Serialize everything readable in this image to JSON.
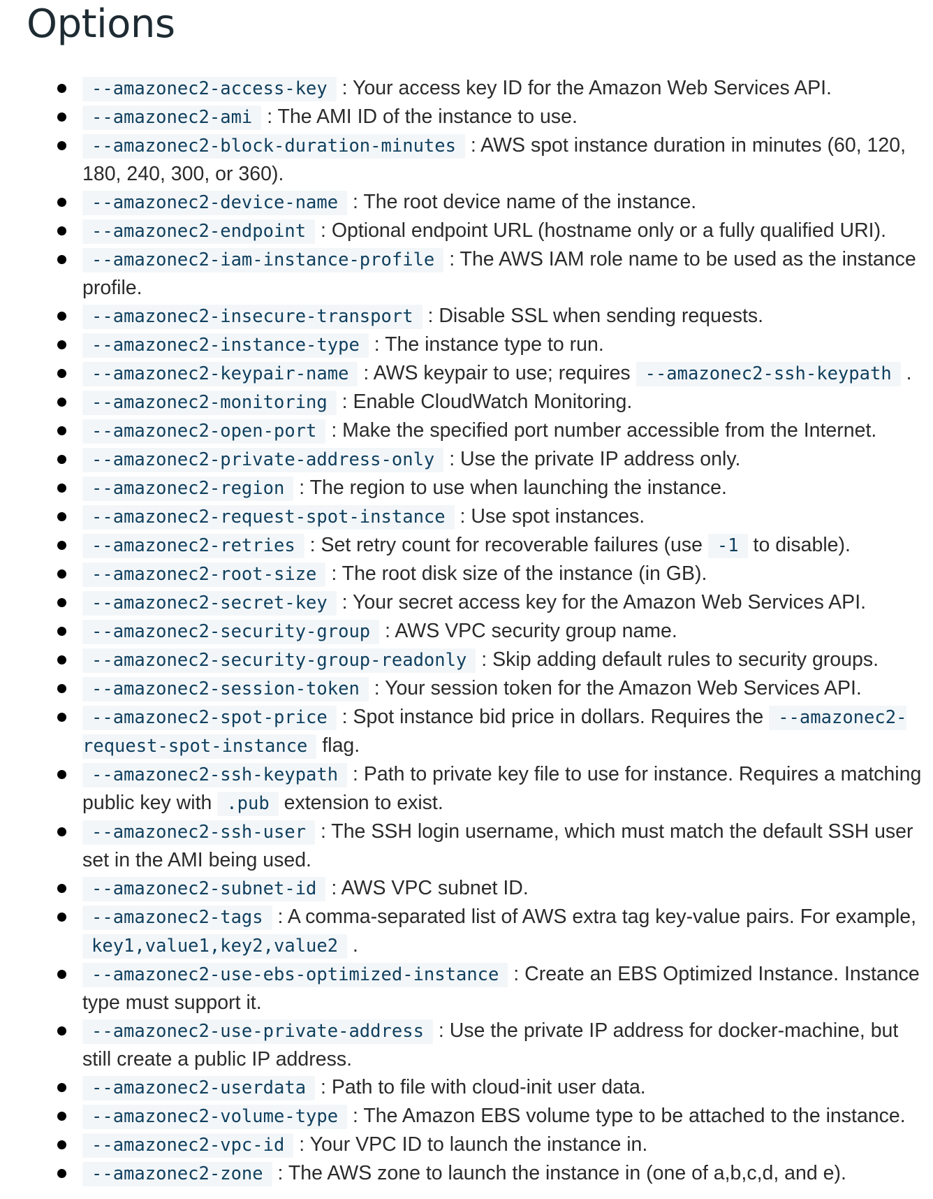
{
  "title": "Options",
  "options": [
    {
      "flag": "--amazonec2-access-key",
      "desc": "Your access key ID for the Amazon Web Services API."
    },
    {
      "flag": "--amazonec2-ami",
      "desc": "The AMI ID of the instance to use."
    },
    {
      "flag": "--amazonec2-block-duration-minutes",
      "desc": "AWS spot instance duration in minutes (60, 120, 180, 240, 300, or 360)."
    },
    {
      "flag": "--amazonec2-device-name",
      "desc": "The root device name of the instance."
    },
    {
      "flag": "--amazonec2-endpoint",
      "desc": "Optional endpoint URL (hostname only or a fully qualified URI)."
    },
    {
      "flag": "--amazonec2-iam-instance-profile",
      "desc": "The AWS IAM role name to be used as the instance profile."
    },
    {
      "flag": "--amazonec2-insecure-transport",
      "desc": "Disable SSL when sending requests."
    },
    {
      "flag": "--amazonec2-instance-type",
      "desc": "The instance type to run."
    },
    {
      "flag": "--amazonec2-keypair-name",
      "desc": "AWS keypair to use; requires",
      "code": "--amazonec2-ssh-keypath",
      "after": "."
    },
    {
      "flag": "--amazonec2-monitoring",
      "desc": "Enable CloudWatch Monitoring."
    },
    {
      "flag": "--amazonec2-open-port",
      "desc": "Make the specified port number accessible from the Internet."
    },
    {
      "flag": "--amazonec2-private-address-only",
      "desc": "Use the private IP address only."
    },
    {
      "flag": "--amazonec2-region",
      "desc": "The region to use when launching the instance."
    },
    {
      "flag": "--amazonec2-request-spot-instance",
      "desc": "Use spot instances."
    },
    {
      "flag": "--amazonec2-retries",
      "desc": "Set retry count for recoverable failures (use",
      "code": "-1",
      "after": "to disable)."
    },
    {
      "flag": "--amazonec2-root-size",
      "desc": "The root disk size of the instance (in GB)."
    },
    {
      "flag": "--amazonec2-secret-key",
      "desc": "Your secret access key for the Amazon Web Services API."
    },
    {
      "flag": "--amazonec2-security-group",
      "desc": "AWS VPC security group name."
    },
    {
      "flag": "--amazonec2-security-group-readonly",
      "desc": "Skip adding default rules to security groups."
    },
    {
      "flag": "--amazonec2-session-token",
      "desc": "Your session token for the Amazon Web Services API."
    },
    {
      "flag": "--amazonec2-spot-price",
      "desc": "Spot instance bid price in dollars. Requires the",
      "code": "--amazonec2-request-spot-instance",
      "after": "flag."
    },
    {
      "flag": "--amazonec2-ssh-keypath",
      "desc": "Path to private key file to use for instance. Requires a matching public key with",
      "code": ".pub",
      "after": "extension to exist."
    },
    {
      "flag": "--amazonec2-ssh-user",
      "desc": "The SSH login username, which must match the default SSH user set in the AMI being used."
    },
    {
      "flag": "--amazonec2-subnet-id",
      "desc": "AWS VPC subnet ID."
    },
    {
      "flag": "--amazonec2-tags",
      "desc": "A comma-separated list of AWS extra tag key-value pairs. For example,",
      "code": "key1,value1,key2,value2",
      "after": "."
    },
    {
      "flag": "--amazonec2-use-ebs-optimized-instance",
      "desc": "Create an EBS Optimized Instance. Instance type must support it."
    },
    {
      "flag": "--amazonec2-use-private-address",
      "desc": "Use the private IP address for docker-machine, but still create a public IP address."
    },
    {
      "flag": "--amazonec2-userdata",
      "desc": "Path to file with cloud-init user data."
    },
    {
      "flag": "--amazonec2-volume-type",
      "desc": "The Amazon EBS volume type to be attached to the instance."
    },
    {
      "flag": "--amazonec2-vpc-id",
      "desc": "Your VPC ID to launch the instance in."
    },
    {
      "flag": "--amazonec2-zone",
      "desc": "The AWS zone to launch the instance in (one of a,b,c,d, and e)."
    }
  ]
}
